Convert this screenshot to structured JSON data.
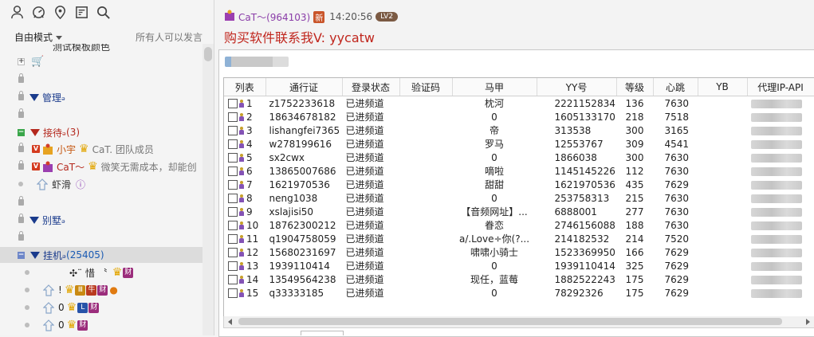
{
  "toolbar_icons": [
    "user-icon",
    "gauge-icon",
    "location-pin-icon",
    "notes-icon",
    "search-icon"
  ],
  "mode_label": "自由模式",
  "speak_status": "所有人可以发言",
  "tree": {
    "partial_top_text": "测试模板颜色",
    "channels": {
      "guanli": {
        "name": "管理",
        "suffix": "ₔ"
      },
      "jiedai": {
        "name": "接待",
        "suffix": "ₔ",
        "count": "(3)"
      },
      "bieshu": {
        "name": "别墅",
        "suffix": "ₔ"
      },
      "guaji": {
        "name": "挂机",
        "suffix": "ₔ",
        "count": "(25405)"
      }
    },
    "users": [
      {
        "name": "小宇",
        "signature": "CaT. 团队成员"
      },
      {
        "name": "CaT～",
        "signature": "微笑无需成本，却能创"
      },
      {
        "name": "虾滑",
        "signature": ""
      }
    ],
    "idle_users": [
      {
        "name": "✣¨ 惜 〝",
        "badge": "财"
      },
      {
        "name": "!",
        "badges": [
          "Ⅲ",
          "牛",
          "财"
        ]
      },
      {
        "name": "0",
        "badges": [
          "L",
          "财"
        ]
      },
      {
        "name": "0",
        "badges": [
          "财"
        ]
      }
    ]
  },
  "message": {
    "sender": "CaT～(964103)",
    "time": "14:20:56",
    "level": "LV2",
    "text": "购买软件联系我V: yycatw"
  },
  "table": {
    "headers": [
      "列表",
      "通行证",
      "登录状态",
      "验证码",
      "马甲",
      "YY号",
      "等级",
      "心跳",
      "YB",
      "代理IP-API"
    ],
    "rows": [
      {
        "n": "1",
        "pass": "z1752233618",
        "status": "已进频道",
        "captcha": "",
        "vest": "枕河",
        "yy": "2221152834",
        "level": "136",
        "hb": "7630",
        "yb": ""
      },
      {
        "n": "2",
        "pass": "18634678182",
        "status": "已进频道",
        "captcha": "",
        "vest": "0",
        "yy": "1605133170",
        "level": "218",
        "hb": "7518",
        "yb": ""
      },
      {
        "n": "3",
        "pass": "lishangfei7365",
        "status": "已进频道",
        "captcha": "",
        "vest": "帝",
        "yy": "313538",
        "level": "300",
        "hb": "3165",
        "yb": ""
      },
      {
        "n": "4",
        "pass": "w278199616",
        "status": "已进频道",
        "captcha": "",
        "vest": "罗马",
        "yy": "12553767",
        "level": "309",
        "hb": "4541",
        "yb": ""
      },
      {
        "n": "5",
        "pass": "sx2cwx",
        "status": "已进频道",
        "captcha": "",
        "vest": "0",
        "yy": "1866038",
        "level": "300",
        "hb": "7630",
        "yb": ""
      },
      {
        "n": "6",
        "pass": "13865007686",
        "status": "已进频道",
        "captcha": "",
        "vest": "嘀啦",
        "yy": "1145145226",
        "level": "112",
        "hb": "7630",
        "yb": ""
      },
      {
        "n": "7",
        "pass": "1621970536",
        "status": "已进频道",
        "captcha": "",
        "vest": "甜甜",
        "yy": "1621970536",
        "level": "435",
        "hb": "7629",
        "yb": ""
      },
      {
        "n": "8",
        "pass": "neng1038",
        "status": "已进频道",
        "captcha": "",
        "vest": "0",
        "yy": "253758313",
        "level": "215",
        "hb": "7630",
        "yb": ""
      },
      {
        "n": "9",
        "pass": "xslajisi50",
        "status": "已进频道",
        "captcha": "",
        "vest": "【音频网址】...",
        "yy": "6888001",
        "level": "277",
        "hb": "7630",
        "yb": ""
      },
      {
        "n": "10",
        "pass": "18762300212",
        "status": "已进频道",
        "captcha": "",
        "vest": "眷恋",
        "yy": "2746156088",
        "level": "188",
        "hb": "7630",
        "yb": ""
      },
      {
        "n": "11",
        "pass": "q1904758059",
        "status": "已进频道",
        "captcha": "",
        "vest": "a/.Love÷你(?...",
        "yy": "214182532",
        "level": "214",
        "hb": "7520",
        "yb": ""
      },
      {
        "n": "12",
        "pass": "15680231697",
        "status": "已进频道",
        "captcha": "",
        "vest": "啸啸小骑士",
        "yy": "1523369950",
        "level": "166",
        "hb": "7629",
        "yb": ""
      },
      {
        "n": "13",
        "pass": "1939110414",
        "status": "已进频道",
        "captcha": "",
        "vest": "0",
        "yy": "1939110414",
        "level": "325",
        "hb": "7629",
        "yb": ""
      },
      {
        "n": "14",
        "pass": "13549564238",
        "status": "已进频道",
        "captcha": "",
        "vest": "现任，蓝莓",
        "yy": "1882522243",
        "level": "175",
        "hb": "7629",
        "yb": ""
      },
      {
        "n": "15",
        "pass": "q33333185",
        "status": "已进频道",
        "captcha": "",
        "vest": "0",
        "yy": "78292326",
        "level": "175",
        "hb": "7629",
        "yb": ""
      }
    ]
  },
  "colors": {
    "accent_red": "#c0261d",
    "channel_blue": "#1a3b8c",
    "name_purple": "#8a3da8"
  }
}
